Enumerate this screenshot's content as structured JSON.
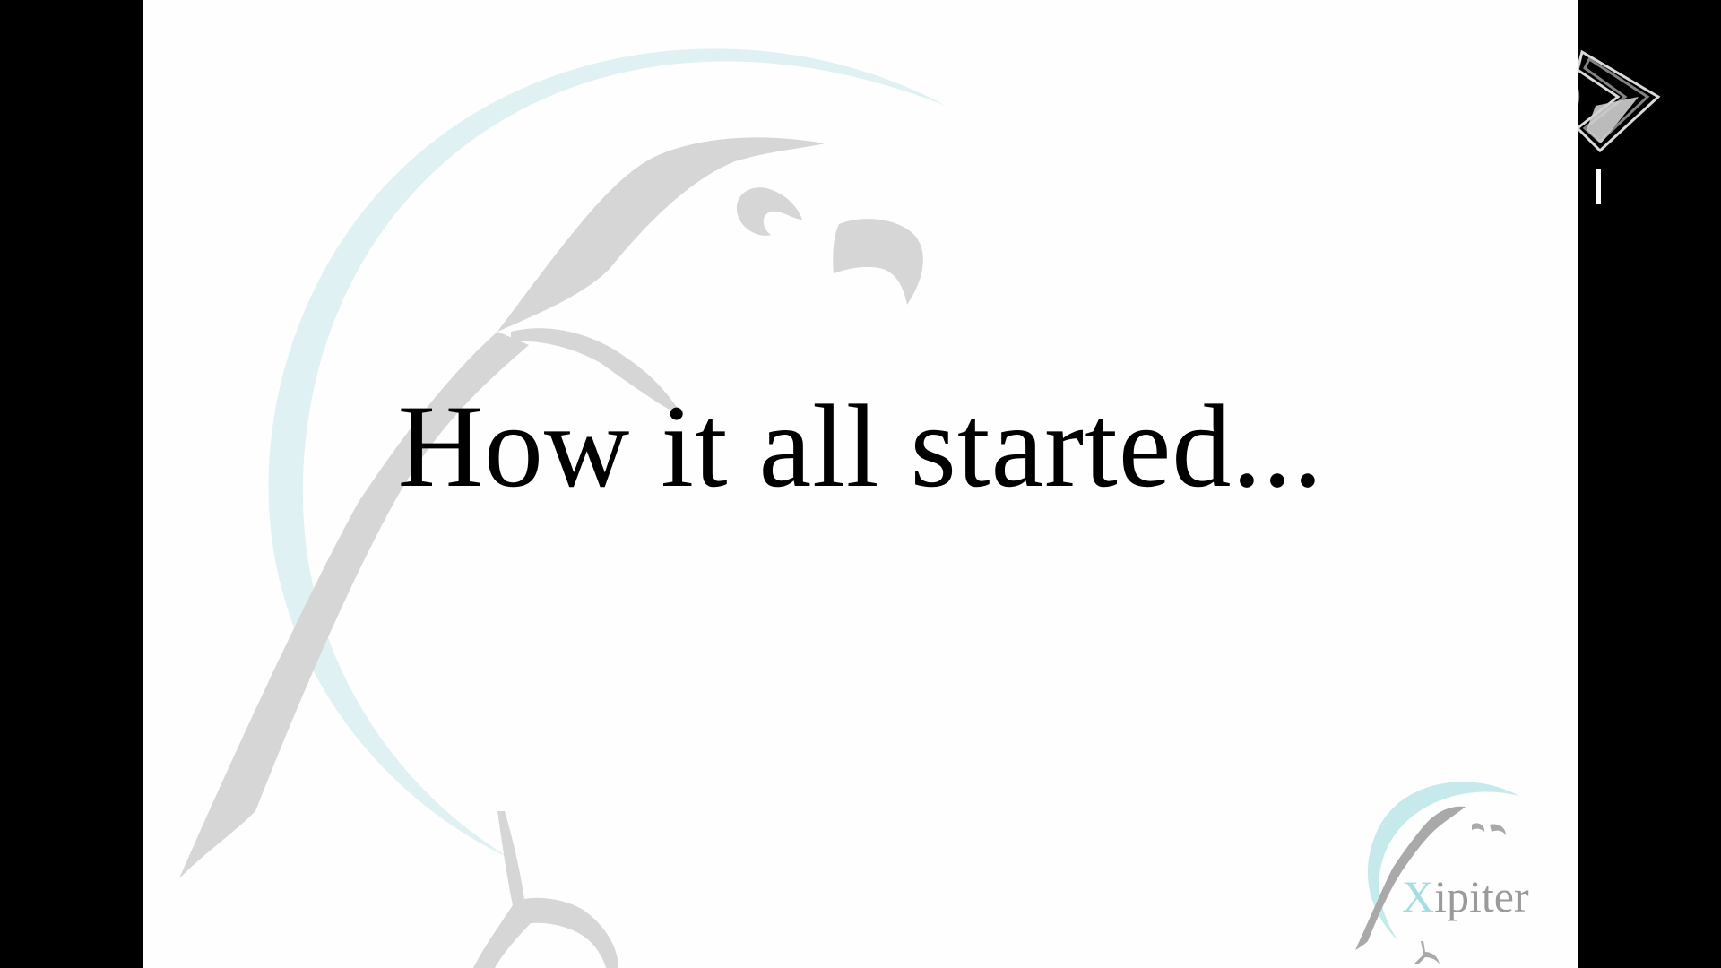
{
  "slide": {
    "title": "How it all started...",
    "background_color": "#fefefe",
    "letterbox_color": "#000000"
  },
  "watermark": {
    "icon": "parrot-logo-icon",
    "arc_color": "#dff1f3",
    "bird_color": "#d6d6d6"
  },
  "corner_logo": {
    "icon": "xipiter-parrot-icon",
    "text_x": "X",
    "text_rest": "ipiter",
    "x_color": "#a6dde2",
    "text_color": "#9a9a9a"
  },
  "channel_badge": {
    "icon": "channel-logo-icon",
    "color": "#ffffff"
  }
}
